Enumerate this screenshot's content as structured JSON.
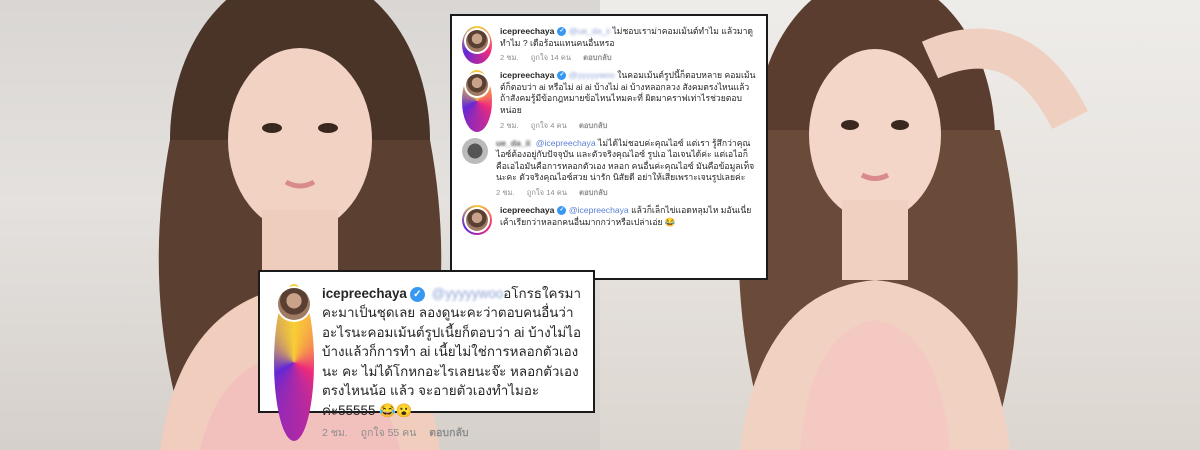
{
  "colors": {
    "verified": "#3897f0",
    "mention": "#5b7fd6",
    "meta": "#8e8e8e",
    "text": "#262626",
    "border": "#1a1a1a"
  },
  "top_panel": {
    "comments": [
      {
        "username": "icepreechaya",
        "verified": true,
        "mention": "@ue_da_ii",
        "text": "ไม่ชอบเราม่าคอมเม้นต์ทำไม แล้วมาดูทำไม ? เดือร้อนแทนคนอื่นหรอ",
        "time": "2 ชม.",
        "likes": "ถูกใจ 14 คน",
        "reply": "ตอบกลับ"
      },
      {
        "username": "icepreechaya",
        "verified": true,
        "mention": "@yyyyywoo",
        "text": "ในคอมเม้นต์รูปนี้ก็ตอบหลาย คอมเม้นต์ก็ตอบว่า ai หรือไม่ ai ai บ้างไม่ ai บ้างหลอกลวง สังคมตรงไหนแล้วถ้าสังคมรู้มีข้อกฎหมายข้อไหนไหมคะที่ ผิดมาคราฟเท่าไรช่วยตอบหน่อย",
        "time": "2 ชม.",
        "likes": "ถูกใจ 4 คน",
        "reply": "ตอบกลับ"
      },
      {
        "username": "ue_da_ii",
        "verified": false,
        "mention": "@icepreechaya",
        "text": "ไม่ได้ไม่ชอบค่ะคุณไอซ์ แต่เรา รู้สึกว่าคุณไอซ์ต้องอยู่กับปัจจุบัน และตัวจริงคุณไอซ์ รูปเอ ไอเจนได้ค่ะ แต่เอไอก็คือเอไอมันคือการหลอกตัวเอง หลอก คนอื่นค่ะคุณไอซ์ มันคือข้อมูลเท็จนะคะ ตัวจริงคุณไอซ์สวย น่ารัก นิสัยดี อย่าให้เสียเพราะเจนรูปเลยค่ะ",
        "time": "2 ชม.",
        "likes": "ถูกใจ 14 คน",
        "reply": "ตอบกลับ"
      },
      {
        "username": "icepreechaya",
        "verified": true,
        "mention": "@icepreechaya",
        "text": "แล้วก็เล็กไข่แอดหลุมไห มอันเนี่ยเค้าเรียกว่าหลอกคนอื่นมากกว่าหรือเปล่าเอ่ย 😂",
        "time": "",
        "likes": "",
        "reply": ""
      }
    ]
  },
  "main_panel": {
    "username": "icepreechaya",
    "verified": true,
    "mention": "@yyyyywoo",
    "text": "อโกรธใครมาคะมาเป็นชุดเลย ลองดูนะคะว่าตอบคนอื่นว่าอะไรนะคอมเม้นต์รูปเนี้ยก็ตอบว่า ai บ้างไม่ไอบ้างแล้วก็การทำ ai เนี้ยไม่ใช่การหลอกตัวเองนะ คะ ไม่ได้โกหกอะไรเลยนะจ๊ะ หลอกตัวเองตรงไหนน้อ แล้ว จะอายตัวเองทำไมอะค่ะ55555 😂😮",
    "time": "2 ชม.",
    "likes": "ถูกใจ 55 คน",
    "reply": "ตอบกลับ"
  }
}
